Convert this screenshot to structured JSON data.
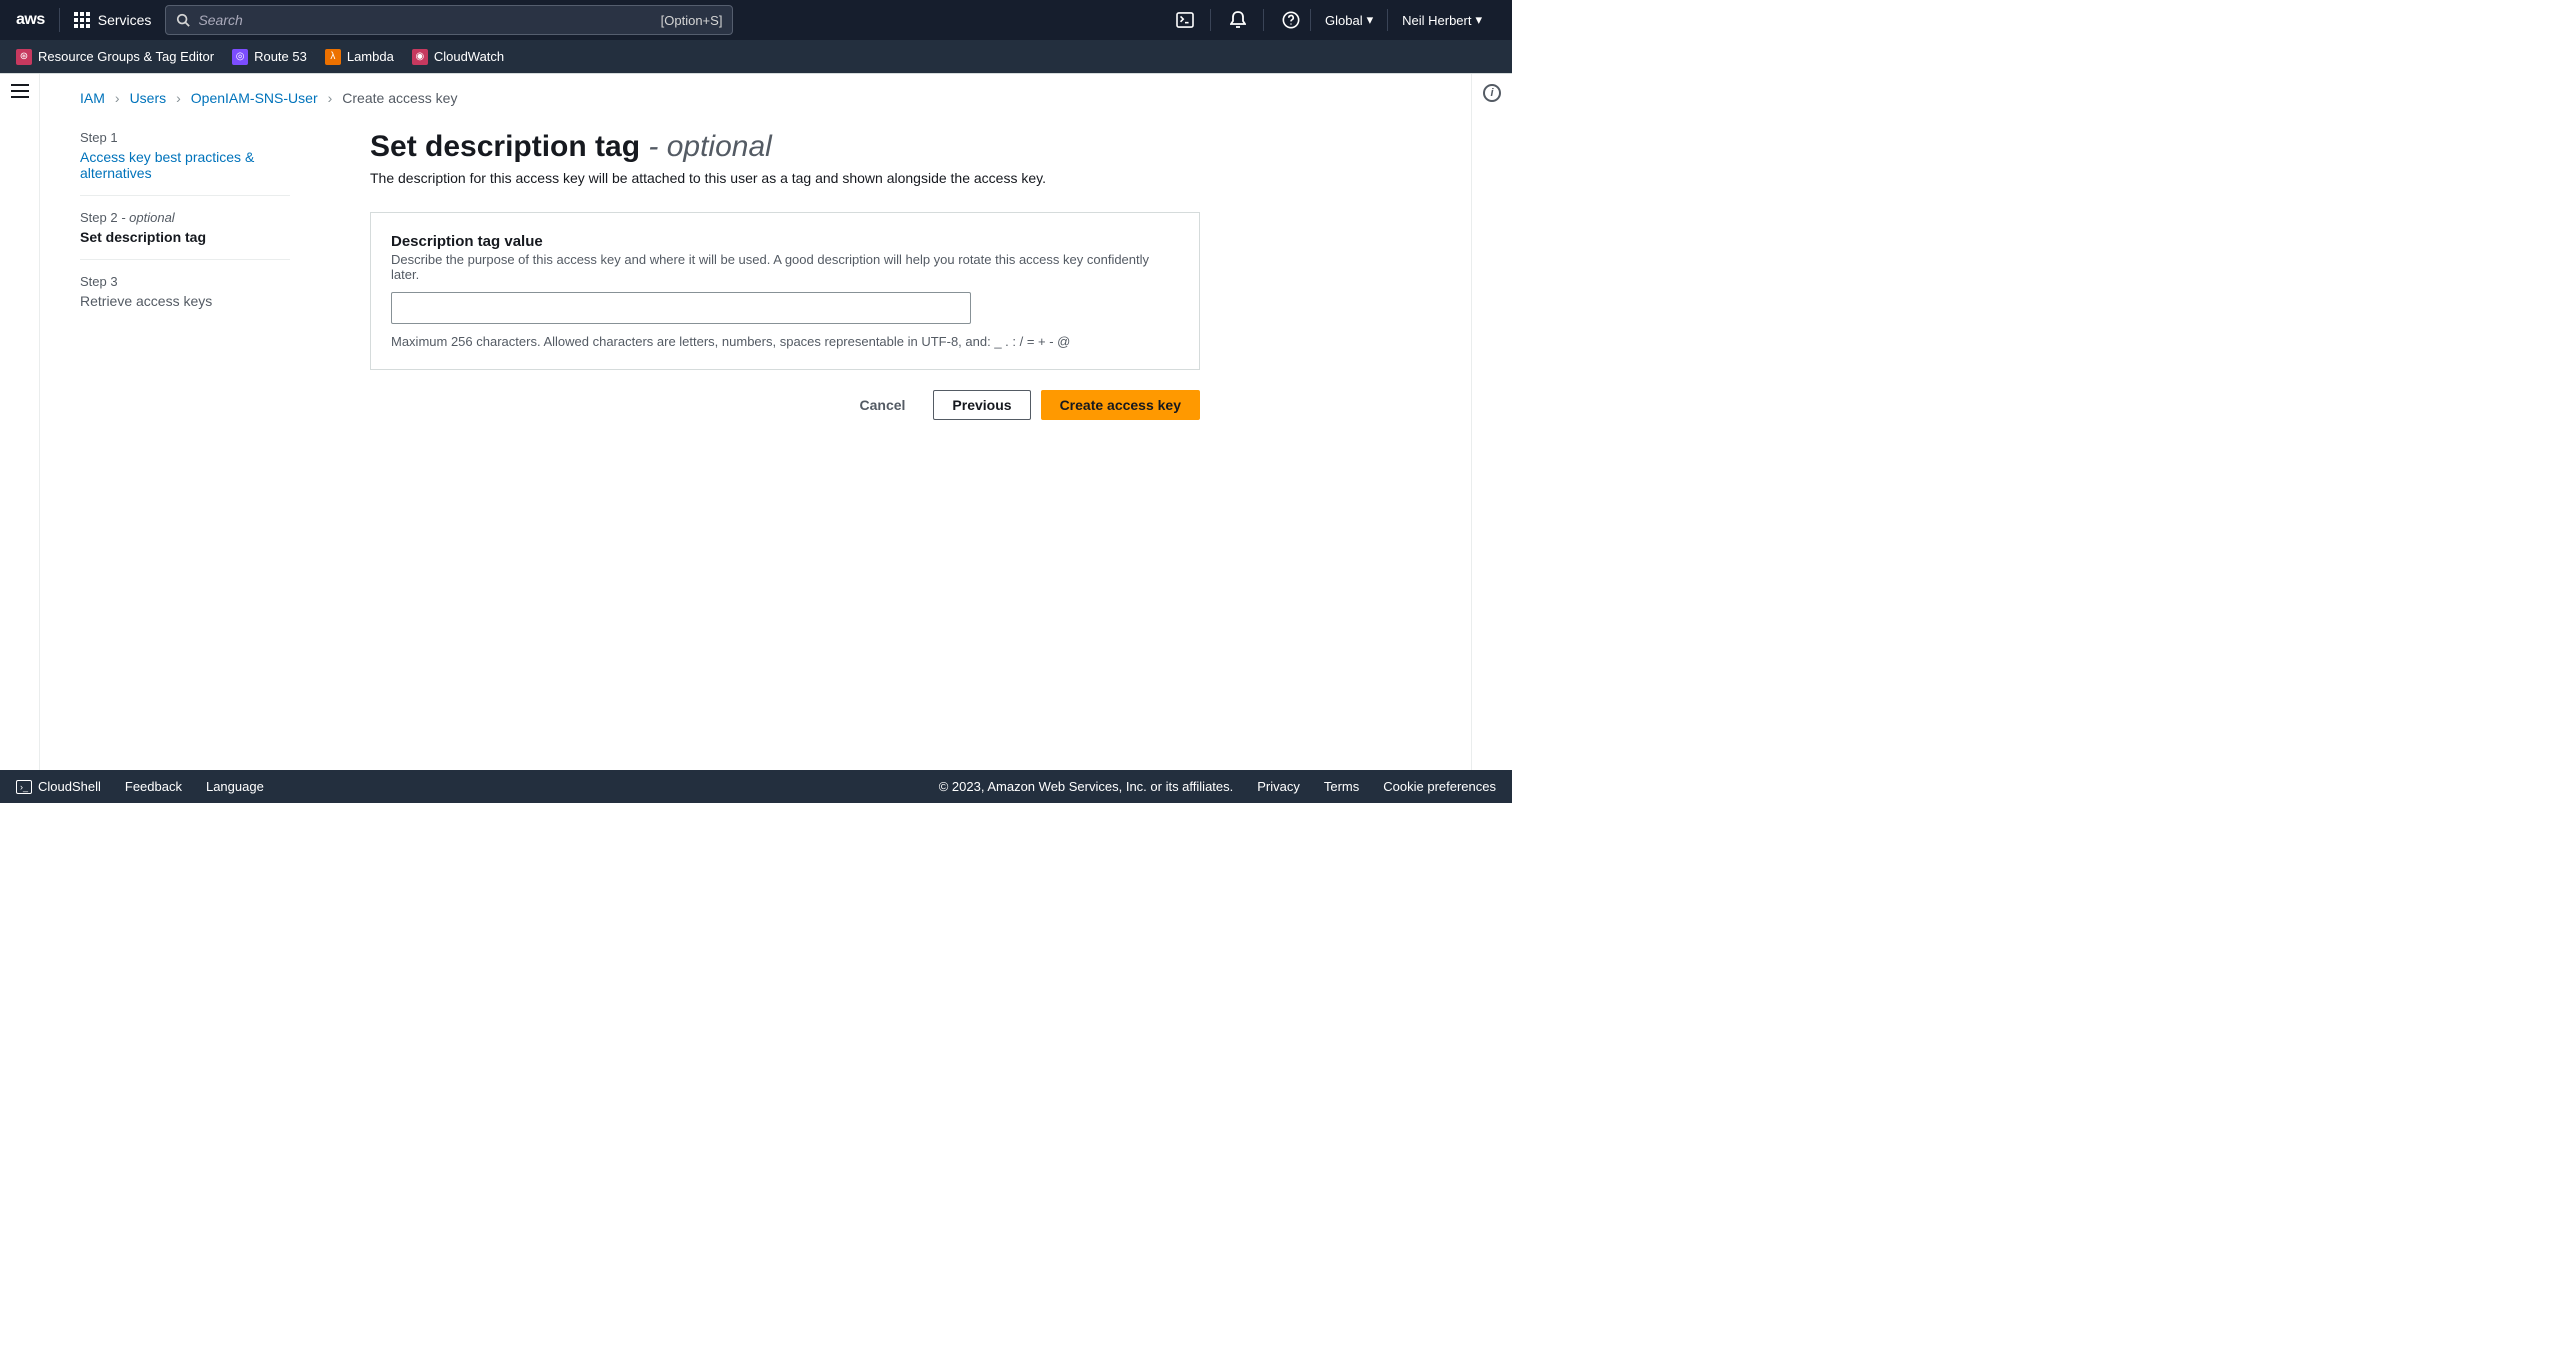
{
  "top_nav": {
    "services_label": "Services",
    "search_placeholder": "Search",
    "search_shortcut": "[Option+S]",
    "region": "Global",
    "user": "Neil Herbert"
  },
  "favorites": [
    {
      "label": "Resource Groups & Tag Editor",
      "color": "#c7395f"
    },
    {
      "label": "Route 53",
      "color": "#7c4dff"
    },
    {
      "label": "Lambda",
      "color": "#ed7100"
    },
    {
      "label": "CloudWatch",
      "color": "#c7395f"
    }
  ],
  "breadcrumb": [
    {
      "label": "IAM",
      "link": true
    },
    {
      "label": "Users",
      "link": true
    },
    {
      "label": "OpenIAM-SNS-User",
      "link": true
    },
    {
      "label": "Create access key",
      "link": false
    }
  ],
  "steps": [
    {
      "label": "Step 1",
      "title": "Access key best practices & alternatives",
      "state": "link"
    },
    {
      "label": "Step 2",
      "label_optional": "- optional",
      "title": "Set description tag",
      "state": "active"
    },
    {
      "label": "Step 3",
      "title": "Retrieve access keys",
      "state": "future"
    }
  ],
  "panel": {
    "heading": "Set description tag",
    "heading_optional": "- optional",
    "description": "The description for this access key will be attached to this user as a tag and shown alongside the access key.",
    "field_label": "Description tag value",
    "field_hint": "Describe the purpose of this access key and where it will be used. A good description will help you rotate this access key confidently later.",
    "field_value": "",
    "constraint": "Maximum 256 characters. Allowed characters are letters, numbers, spaces representable in UTF-8, and: _ . : / = + - @"
  },
  "buttons": {
    "cancel": "Cancel",
    "previous": "Previous",
    "primary": "Create access key"
  },
  "footer": {
    "cloudshell": "CloudShell",
    "feedback": "Feedback",
    "language": "Language",
    "copyright": "© 2023, Amazon Web Services, Inc. or its affiliates.",
    "privacy": "Privacy",
    "terms": "Terms",
    "cookies": "Cookie preferences"
  }
}
